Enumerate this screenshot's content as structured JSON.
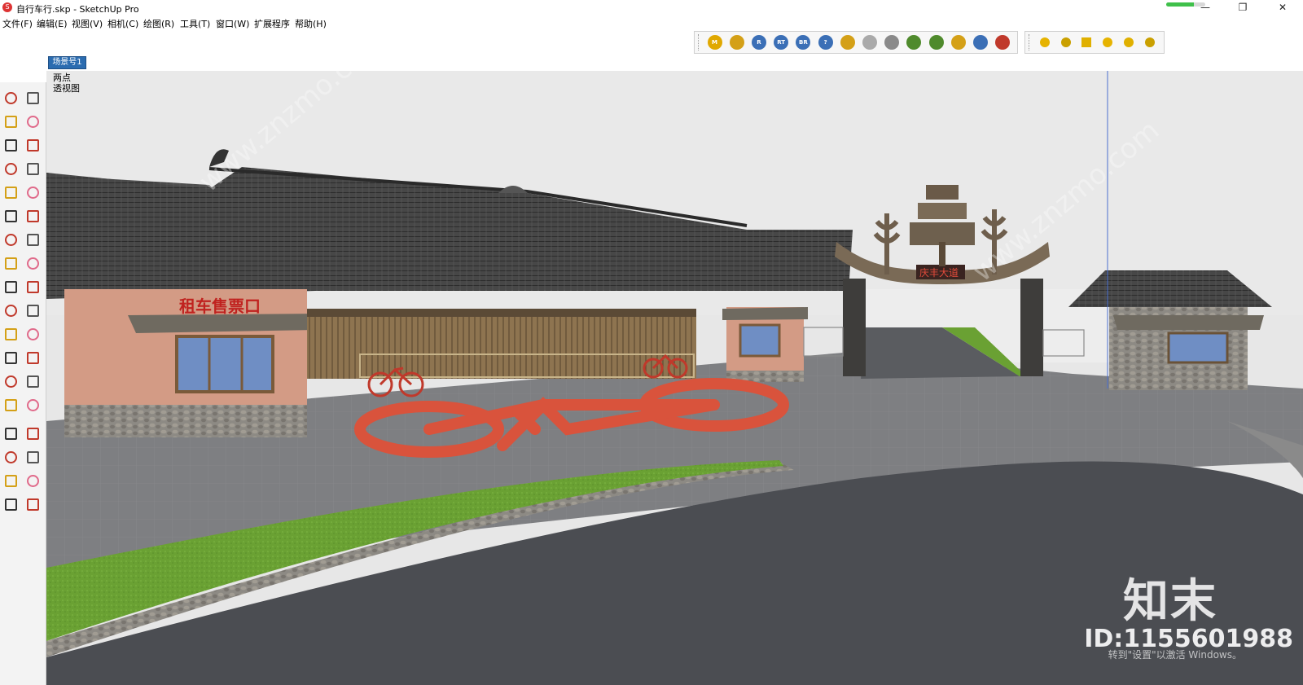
{
  "window": {
    "title": "自行车行.skp - SketchUp Pro",
    "controls": {
      "minimize": "—",
      "restore": "❐",
      "close": "✕"
    },
    "progress_fraction": 0.7,
    "progress_color": "#3fc04a"
  },
  "menu": [
    {
      "label": "文件(F)"
    },
    {
      "label": "编辑(E)"
    },
    {
      "label": "视图(V)"
    },
    {
      "label": "相机(C)"
    },
    {
      "label": "绘图(R)"
    },
    {
      "label": "工具(T)"
    },
    {
      "label": "窗口(W)"
    },
    {
      "label": "扩展程序"
    },
    {
      "label": "帮助(H)"
    }
  ],
  "plugin_toolbar": [
    {
      "icon": "m-plugin-icon",
      "text": "M",
      "color": "#e0a800"
    },
    {
      "icon": "tag-icon",
      "text": "",
      "color": "#d4a017"
    },
    {
      "icon": "r-plugin-icon",
      "text": "R",
      "color": "#3b6fb6"
    },
    {
      "icon": "rt-plugin-icon",
      "text": "RT",
      "color": "#3b6fb6"
    },
    {
      "icon": "br-plugin-icon",
      "text": "BR",
      "color": "#3b6fb6"
    },
    {
      "icon": "help-icon",
      "text": "?",
      "color": "#3b6fb6"
    },
    {
      "icon": "label-icon",
      "text": "",
      "color": "#d4a017"
    },
    {
      "icon": "sphere-icon",
      "text": "",
      "color": "#aaaaaa"
    },
    {
      "icon": "scatter-icon",
      "text": "",
      "color": "#8a8a8a"
    },
    {
      "icon": "tree-icon",
      "text": "",
      "color": "#4f8a2c"
    },
    {
      "icon": "plant-icon",
      "text": "",
      "color": "#4f8a2c"
    },
    {
      "icon": "target-icon",
      "text": "",
      "color": "#d4a017"
    },
    {
      "icon": "pause-icon",
      "text": "",
      "color": "#3b6fb6"
    },
    {
      "icon": "color-wheel-icon",
      "text": "",
      "color": "#c0392b"
    }
  ],
  "shadow_toolbar": [
    {
      "icon": "sun-icon"
    },
    {
      "icon": "lamp-icon"
    },
    {
      "icon": "flag-icon"
    },
    {
      "icon": "dome-icon"
    },
    {
      "icon": "ball-icon"
    },
    {
      "icon": "sun-flag-icon"
    }
  ],
  "scene_tab": {
    "label": "场景号1"
  },
  "left_tools": [
    {
      "name": "select-icon"
    },
    {
      "name": "make-component-icon"
    },
    {
      "name": "paint-bucket-icon"
    },
    {
      "name": "eraser-icon"
    },
    {
      "name": "pencil-icon"
    },
    {
      "name": "freehand-icon"
    },
    {
      "name": "rectangle-icon"
    },
    {
      "name": "rotated-rectangle-icon"
    },
    {
      "name": "circle-icon"
    },
    {
      "name": "polygon-icon"
    },
    {
      "name": "arc-icon"
    },
    {
      "name": "two-point-arc-icon"
    },
    {
      "name": "three-point-arc-icon"
    },
    {
      "name": "pie-icon"
    },
    {
      "name": "move-icon"
    },
    {
      "name": "push-pull-icon"
    },
    {
      "name": "rotate-icon"
    },
    {
      "name": "follow-me-icon"
    },
    {
      "name": "scale-icon"
    },
    {
      "name": "offset-icon"
    },
    {
      "name": "tape-measure-icon"
    },
    {
      "name": "dimension-icon"
    },
    {
      "name": "protractor-icon"
    },
    {
      "name": "text-icon"
    },
    {
      "name": "axes-icon"
    },
    {
      "name": "3d-text-icon"
    },
    {
      "name": "orbit-icon"
    },
    {
      "name": "pan-icon"
    },
    {
      "name": "zoom-icon"
    },
    {
      "name": "zoom-window-icon"
    },
    {
      "name": "zoom-extents-icon"
    },
    {
      "name": "previous-view-icon"
    },
    {
      "name": "position-camera-icon"
    },
    {
      "name": "look-around-icon"
    },
    {
      "name": "walk-icon"
    },
    {
      "name": "section-plane-icon"
    }
  ],
  "viewport": {
    "label_line1": "两点",
    "label_line2": "透视图"
  },
  "scene": {
    "ticket_sign": "租车售票口",
    "gate_sign": "庆丰大道",
    "watermark_url": "www.znzmo.com",
    "watermark_logo": "知末",
    "watermark_id": "ID:1155601988",
    "activate_text": "转到\"设置\"以激活 Windows。",
    "colors": {
      "sky": "#e9e9e9",
      "roof": "#4a4a4a",
      "wall": "#d39b85",
      "paving": "#7e7f82",
      "road": "#4b4d52",
      "grass": "#6aa133",
      "bike": "#d9533c",
      "window": "#6f8ec4"
    }
  }
}
